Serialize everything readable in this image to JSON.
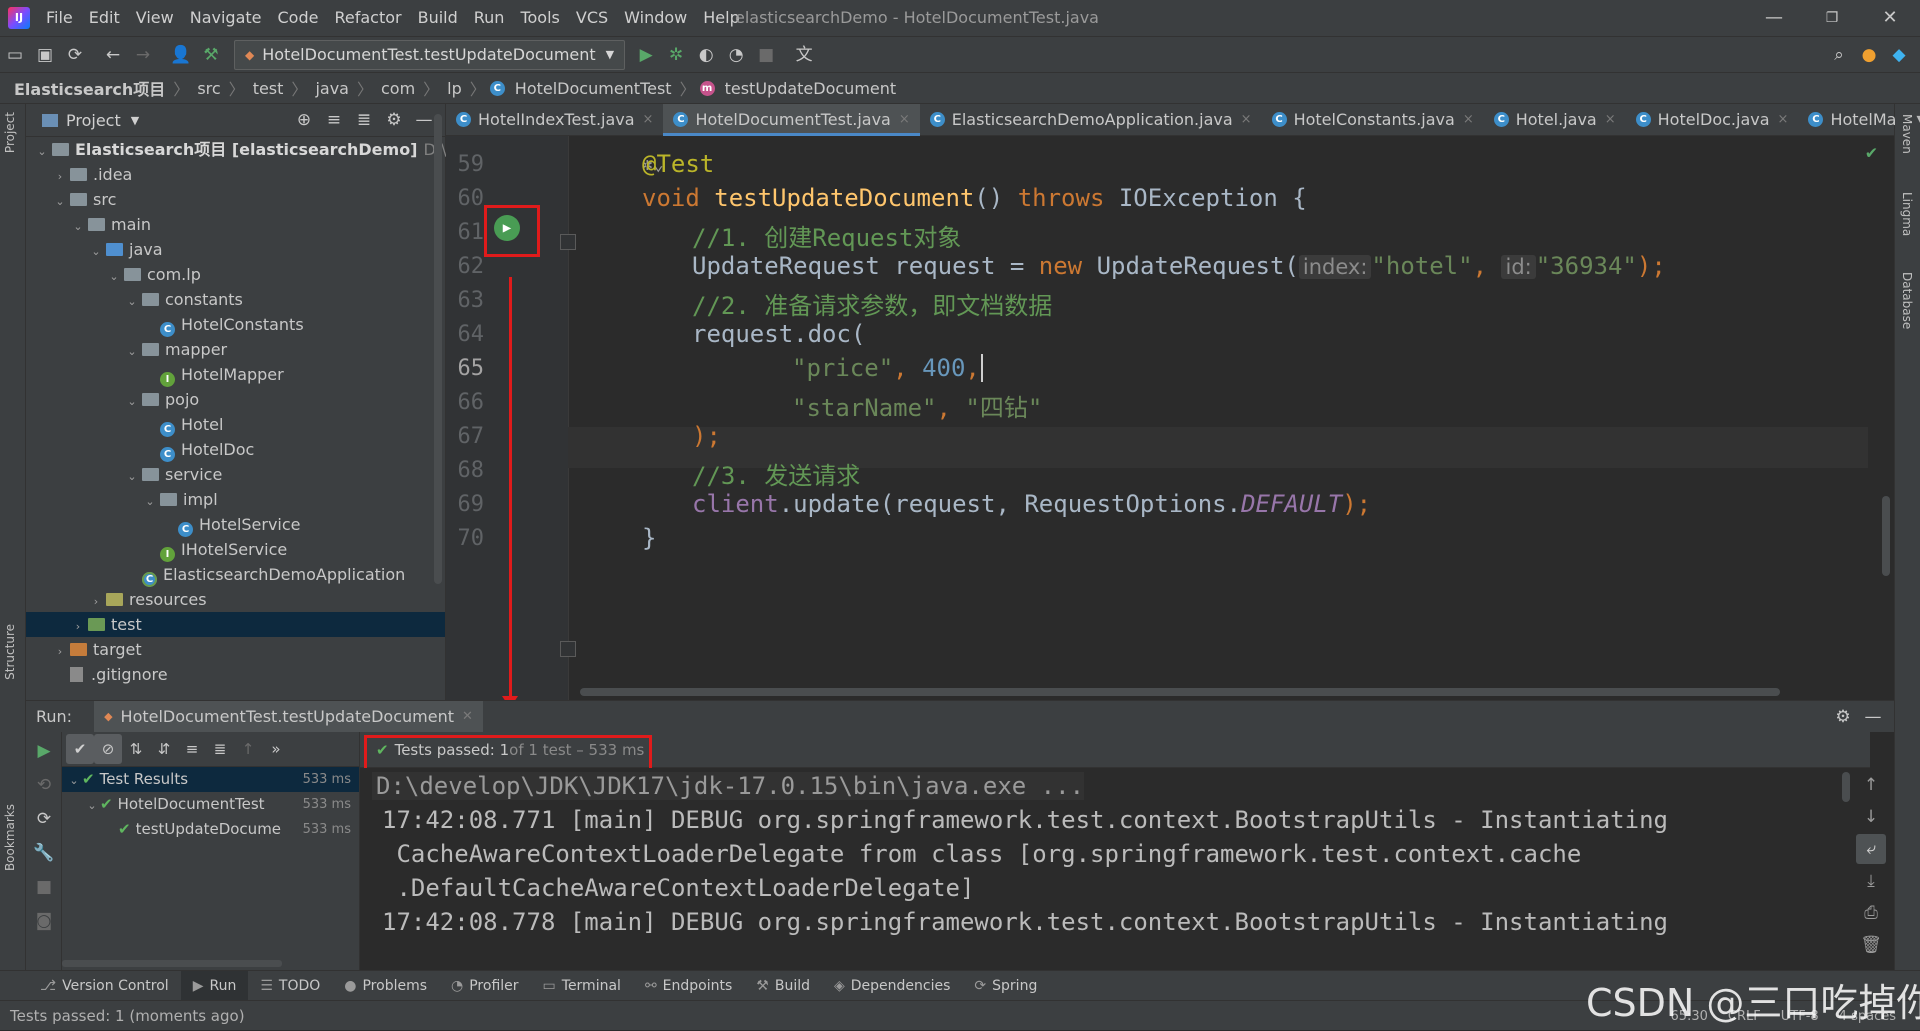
{
  "app": {
    "logo_text": "IJ",
    "window_title": "elasticsearchDemo - HotelDocumentTest.java",
    "menu": [
      "File",
      "Edit",
      "View",
      "Navigate",
      "Code",
      "Refactor",
      "Build",
      "Run",
      "Tools",
      "VCS",
      "Window",
      "Help"
    ],
    "window_controls": {
      "minimize": "—",
      "restore": "❐",
      "close": "✕"
    }
  },
  "toolbar": {
    "run_configuration": "HotelDocumentTest.testUpdateDocument"
  },
  "breadcrumb": [
    "Elasticsearch项目",
    "src",
    "test",
    "java",
    "com",
    "lp",
    "HotelDocumentTest",
    "testUpdateDocument"
  ],
  "left_stripe": {
    "project": "Project",
    "structure": "Structure",
    "bookmarks": "Bookmarks"
  },
  "right_stripe": {
    "maven": "Maven",
    "lingma": "Lingma",
    "database": "Database"
  },
  "project_panel": {
    "title": "Project",
    "tree": [
      {
        "label": "Elasticsearch项目 [elasticsearchDemo]",
        "bold": "Elasticsearch项目 [elasticsearchDemo]",
        "path": "D:\\develop",
        "indent": 0,
        "arrow": "▼",
        "icon": "folder"
      },
      {
        "label": ".idea",
        "indent": 1,
        "arrow": "▶",
        "icon": "folder"
      },
      {
        "label": "src",
        "indent": 1,
        "arrow": "▼",
        "icon": "folder"
      },
      {
        "label": "main",
        "indent": 2,
        "arrow": "▼",
        "icon": "folder"
      },
      {
        "label": "java",
        "indent": 3,
        "arrow": "▼",
        "icon": "src"
      },
      {
        "label": "com.lp",
        "indent": 4,
        "arrow": "▼",
        "icon": "folder"
      },
      {
        "label": "constants",
        "indent": 5,
        "arrow": "▼",
        "icon": "folder"
      },
      {
        "label": "HotelConstants",
        "indent": 6,
        "arrow": "",
        "icon": "class"
      },
      {
        "label": "mapper",
        "indent": 5,
        "arrow": "▼",
        "icon": "folder"
      },
      {
        "label": "HotelMapper",
        "indent": 6,
        "arrow": "",
        "icon": "iface"
      },
      {
        "label": "pojo",
        "indent": 5,
        "arrow": "▼",
        "icon": "folder"
      },
      {
        "label": "Hotel",
        "indent": 6,
        "arrow": "",
        "icon": "class"
      },
      {
        "label": "HotelDoc",
        "indent": 6,
        "arrow": "",
        "icon": "class"
      },
      {
        "label": "service",
        "indent": 5,
        "arrow": "▼",
        "icon": "folder"
      },
      {
        "label": "impl",
        "indent": 6,
        "arrow": "▼",
        "icon": "folder"
      },
      {
        "label": "HotelService",
        "indent": 7,
        "arrow": "",
        "icon": "class"
      },
      {
        "label": "IHotelService",
        "indent": 6,
        "arrow": "",
        "icon": "iface"
      },
      {
        "label": "ElasticsearchDemoApplication",
        "indent": 5,
        "arrow": "",
        "icon": "app"
      },
      {
        "label": "resources",
        "indent": 3,
        "arrow": "▶",
        "icon": "res"
      },
      {
        "label": "test",
        "indent": 2,
        "arrow": "▶",
        "icon": "test",
        "selected": true
      },
      {
        "label": "target",
        "indent": 1,
        "arrow": "▶",
        "icon": "target"
      },
      {
        "label": ".gitignore",
        "indent": 1,
        "arrow": "",
        "icon": "file"
      }
    ]
  },
  "editor_tabs": [
    {
      "label": "HotelIndexTest.java",
      "active": false
    },
    {
      "label": "HotelDocumentTest.java",
      "active": true
    },
    {
      "label": "ElasticsearchDemoApplication.java",
      "active": false
    },
    {
      "label": "HotelConstants.java",
      "active": false
    },
    {
      "label": "Hotel.java",
      "active": false
    },
    {
      "label": "HotelDoc.java",
      "active": false
    },
    {
      "label": "HotelMa",
      "active": false
    }
  ],
  "editor": {
    "line_numbers": [
      "59",
      "60",
      "61",
      "62",
      "63",
      "64",
      "65",
      "66",
      "67",
      "68",
      "69",
      "70"
    ],
    "current_line": "65",
    "code": {
      "l59_annotation": "@Test",
      "l60_void": "void",
      "l60_name": "testUpdateDocument",
      "l60_parens": "()",
      "l60_throws": "throws",
      "l60_exc": "IOException {",
      "l61_comment": "//1. 创建Request对象",
      "l62_type": "UpdateRequest request = ",
      "l62_new": "new",
      "l62_ctor": " UpdateRequest(",
      "l62_hint_index": "index:",
      "l62_str_index": "\"hotel\"",
      "l62_comma": ", ",
      "l62_hint_id": "id:",
      "l62_str_id": "\"36934\"",
      "l62_end": ");",
      "l63_comment": "//2. 准备请求参数，即文档数据",
      "l64_call": "request.doc(",
      "l65_str": "\"price\"",
      "l65_comma": ", ",
      "l65_num": "400",
      "l65_end": ",",
      "l66_str1": "\"starName\"",
      "l66_comma": ", ",
      "l66_str2": "\"四钻\"",
      "l67_end": ");",
      "l68_comment": "//3. 发送请求",
      "l69_client": "client",
      "l69_rest": ".update(request, RequestOptions.",
      "l69_const": "DEFAULT",
      "l69_end": ");",
      "l70_brace": "}"
    }
  },
  "run_panel": {
    "label": "Run:",
    "tab": "HotelDocumentTest.testUpdateDocument",
    "status_main": "Tests passed: 1",
    "status_dim": " of 1 test – 533 ms",
    "test_tree": [
      {
        "label": "Test Results",
        "duration": "533 ms",
        "indent": 0,
        "arrow": "▼",
        "selected": true
      },
      {
        "label": "HotelDocumentTest",
        "duration": "533 ms",
        "indent": 1,
        "arrow": "▼"
      },
      {
        "label": "testUpdateDocume",
        "duration": "533 ms",
        "indent": 2,
        "arrow": ""
      }
    ],
    "console": [
      "D:\\develop\\JDK\\JDK17\\jdk-17.0.15\\bin\\java.exe ...",
      "17:42:08.771 [main] DEBUG org.springframework.test.context.BootstrapUtils - Instantiating",
      " CacheAwareContextLoaderDelegate from class [org.springframework.test.context.cache",
      " .DefaultCacheAwareContextLoaderDelegate]",
      "17:42:08.778 [main] DEBUG org.springframework.test.context.BootstrapUtils - Instantiating"
    ]
  },
  "tool_windows": [
    "Version Control",
    "Run",
    "TODO",
    "Problems",
    "Profiler",
    "Terminal",
    "Endpoints",
    "Build",
    "Dependencies",
    "Spring"
  ],
  "status_bar": {
    "message": "Tests passed: 1 (moments ago)",
    "position": "65:30",
    "line_sep": "CRLF",
    "encoding": "UTF-8",
    "indent": "4 spaces"
  },
  "watermark": "CSDN @三口吃掉你"
}
